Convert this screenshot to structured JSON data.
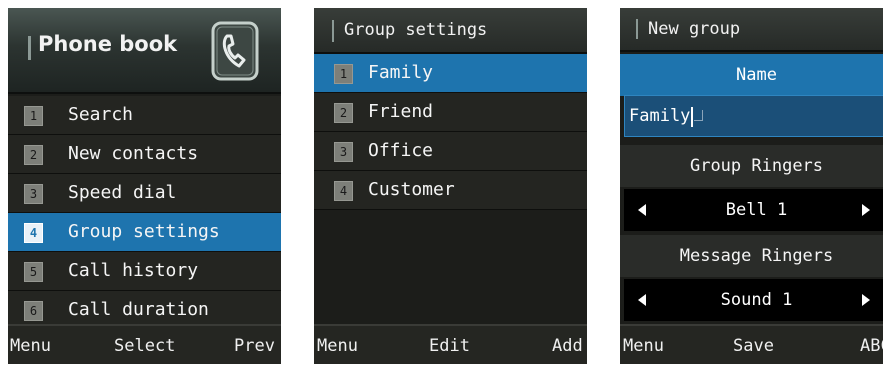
{
  "screen1": {
    "title": "Phone book",
    "icon": "phone-book-icon",
    "items": [
      {
        "num": "1",
        "label": "Search"
      },
      {
        "num": "2",
        "label": "New contacts"
      },
      {
        "num": "3",
        "label": "Speed dial"
      },
      {
        "num": "4",
        "label": "Group settings",
        "selected": true
      },
      {
        "num": "5",
        "label": "Call history"
      },
      {
        "num": "6",
        "label": "Call duration"
      }
    ],
    "softkeys": {
      "left": "Menu",
      "center": "Select",
      "right": "Prev"
    }
  },
  "screen2": {
    "title": "Group settings",
    "items": [
      {
        "num": "1",
        "label": "Family",
        "selected": true
      },
      {
        "num": "2",
        "label": "Friend"
      },
      {
        "num": "3",
        "label": "Office"
      },
      {
        "num": "4",
        "label": "Customer"
      }
    ],
    "softkeys": {
      "left": "Menu",
      "center": "Edit",
      "right": "Add"
    }
  },
  "screen3": {
    "title": "New group",
    "name_label": "Name",
    "name_value": "Family",
    "group_ringers_label": "Group Ringers",
    "group_ringers_value": "Bell 1",
    "message_ringers_label": "Message Ringers",
    "message_ringers_value": "Sound 1",
    "softkeys": {
      "left": "Menu",
      "center": "Save",
      "right": "ABC"
    }
  },
  "colors": {
    "selection": "#1e74ae",
    "background": "#1c1d1a",
    "text": "#f5f5f5"
  }
}
